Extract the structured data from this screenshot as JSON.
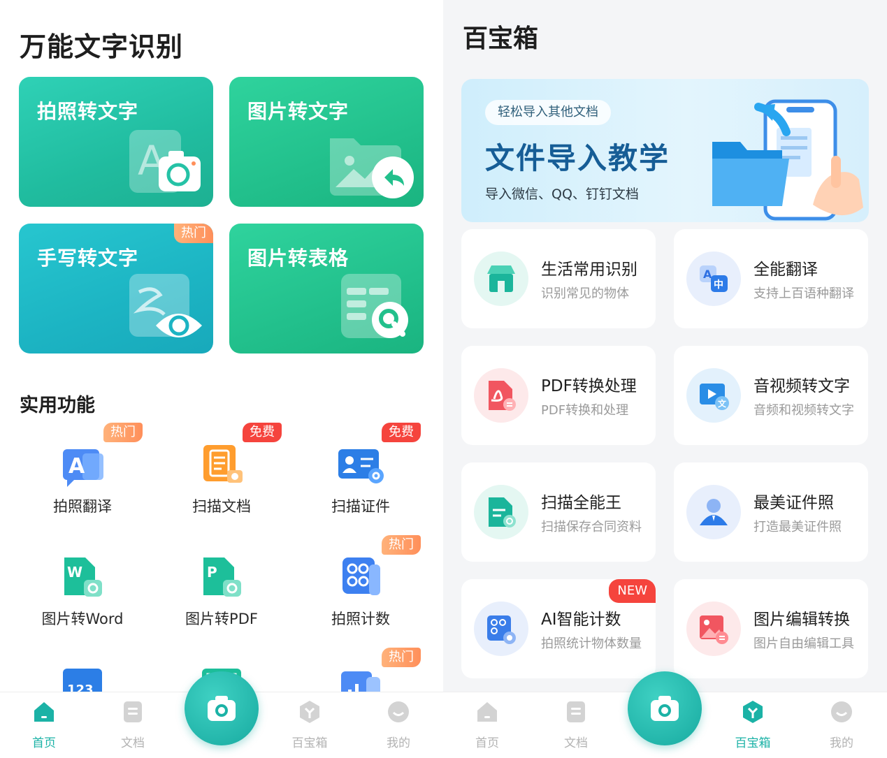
{
  "left": {
    "title": "万能文字识别",
    "cards": [
      {
        "label": "拍照转文字"
      },
      {
        "label": "图片转文字"
      },
      {
        "label": "手写转文字",
        "tag": "热门"
      },
      {
        "label": "图片转表格"
      }
    ],
    "section_title": "实用功能",
    "functions": [
      {
        "label": "拍照翻译",
        "tag": "热门",
        "icon": "translate-photo-icon"
      },
      {
        "label": "扫描文档",
        "tag": "免费",
        "icon": "scan-doc-icon"
      },
      {
        "label": "扫描证件",
        "tag": "免费",
        "icon": "id-card-icon"
      },
      {
        "label": "图片转Word",
        "icon": "word-convert-icon"
      },
      {
        "label": "图片转PDF",
        "icon": "pdf-convert-icon"
      },
      {
        "label": "拍照计数",
        "tag": "热门",
        "icon": "count-icon"
      },
      {
        "icon": "number-scan-icon"
      },
      {
        "icon": "scan-frame-icon"
      },
      {
        "tag": "热门",
        "icon": "chart-icon"
      }
    ],
    "nav": [
      {
        "label": "首页",
        "icon": "home-icon",
        "active": true
      },
      {
        "label": "文档",
        "icon": "document-icon"
      },
      {
        "label": "百宝箱",
        "icon": "toolbox-icon"
      },
      {
        "label": "我的",
        "icon": "profile-icon"
      }
    ]
  },
  "right": {
    "title": "百宝箱",
    "banner": {
      "pill": "轻松导入其他文档",
      "title": "文件导入教学",
      "subtitle": "导入微信、QQ、钉钉文档"
    },
    "tools": [
      {
        "name": "生活常用识别",
        "desc": "识别常见的物体",
        "icon": "store-icon"
      },
      {
        "name": "全能翻译",
        "desc": "支持上百语种翻译",
        "icon": "translate-icon"
      },
      {
        "name": "PDF转换处理",
        "desc": "PDF转换和处理",
        "icon": "pdf-icon"
      },
      {
        "name": "音视频转文字",
        "desc": "音频和视频转文字",
        "icon": "video-text-icon"
      },
      {
        "name": "扫描全能王",
        "desc": "扫描保存合同资料",
        "icon": "scan-master-icon"
      },
      {
        "name": "最美证件照",
        "desc": "打造最美证件照",
        "icon": "id-photo-icon"
      },
      {
        "name": "AI智能计数",
        "desc": "拍照统计物体数量",
        "icon": "ai-count-icon",
        "tag": "NEW"
      },
      {
        "name": "图片编辑转换",
        "desc": "图片自由编辑工具",
        "icon": "image-edit-icon"
      }
    ],
    "nav": [
      {
        "label": "首页",
        "icon": "home-icon"
      },
      {
        "label": "文档",
        "icon": "document-icon"
      },
      {
        "label": "百宝箱",
        "icon": "toolbox-icon",
        "active": true
      },
      {
        "label": "我的",
        "icon": "profile-icon"
      }
    ]
  },
  "colors": {
    "accent": "#1bb2a6",
    "hot": "#ff8f5a",
    "free": "#f5443d",
    "inactive": "#b3b3b3"
  }
}
